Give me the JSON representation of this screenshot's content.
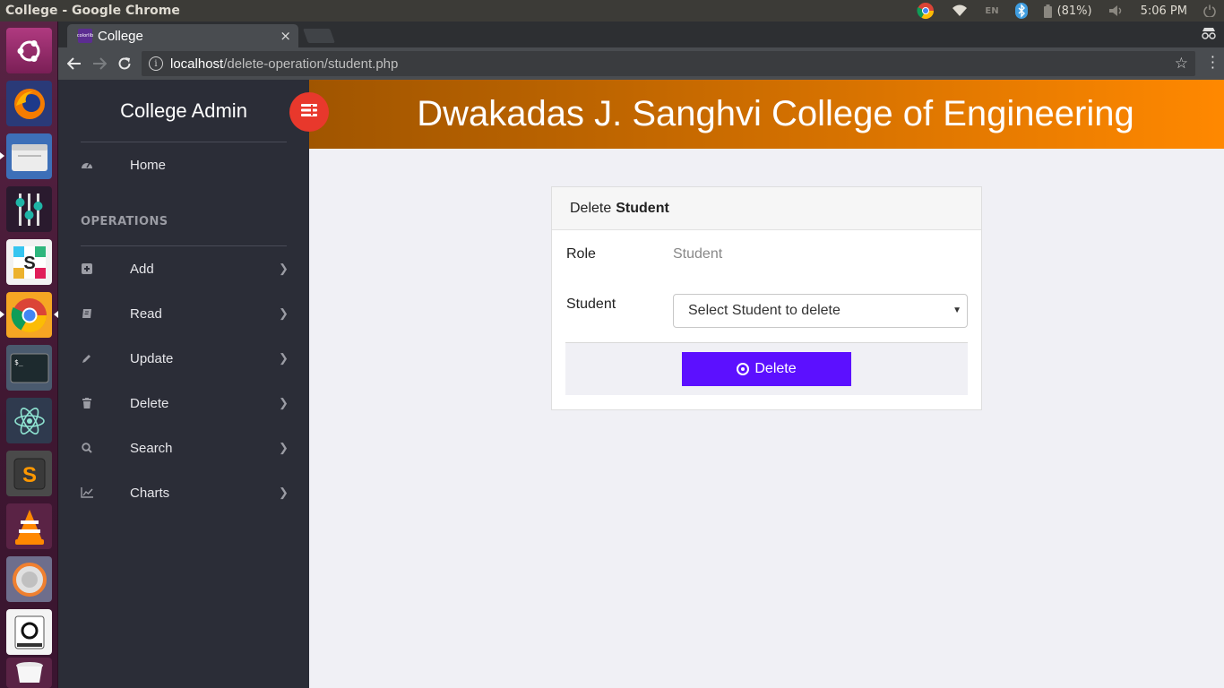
{
  "os": {
    "window_title": "College - Google Chrome",
    "battery": "(81%)",
    "time": "5:06 PM",
    "keyboard": "EN"
  },
  "launcher": {
    "apps": [
      "ubuntu-dash",
      "firefox",
      "files",
      "settings",
      "slack",
      "chrome",
      "terminal",
      "atom",
      "sublime-text",
      "vlc",
      "software-updater",
      "disk",
      "trash"
    ]
  },
  "browser": {
    "tab_title": "College",
    "tab_favicon_text": "colorlib",
    "tab_close": "×",
    "url_host": "localhost",
    "url_path": "/delete-operation/student.php"
  },
  "sidebar": {
    "brand": "College Admin",
    "home_label": "Home",
    "section_title": "OPERATIONS",
    "items": [
      {
        "label": "Add",
        "icon": "plus-square-icon"
      },
      {
        "label": "Read",
        "icon": "book-icon"
      },
      {
        "label": "Update",
        "icon": "pencil-icon"
      },
      {
        "label": "Delete",
        "icon": "trash-icon"
      },
      {
        "label": "Search",
        "icon": "search-icon"
      },
      {
        "label": "Charts",
        "icon": "line-chart-icon"
      }
    ]
  },
  "header": {
    "title": "Dwakadas J. Sanghvi College of Engineering"
  },
  "form": {
    "header_prefix": "Delete",
    "header_bold": "Student",
    "role_label": "Role",
    "role_value": "Student",
    "student_label": "Student",
    "student_select_value": "Select Student to delete",
    "delete_label": "Delete"
  },
  "colors": {
    "accent_button": "#5c10ff",
    "toggle_button": "#e8382c",
    "banner_start": "#a05500",
    "banner_end": "#ff8800",
    "sidebar_bg": "#2b2d37"
  }
}
